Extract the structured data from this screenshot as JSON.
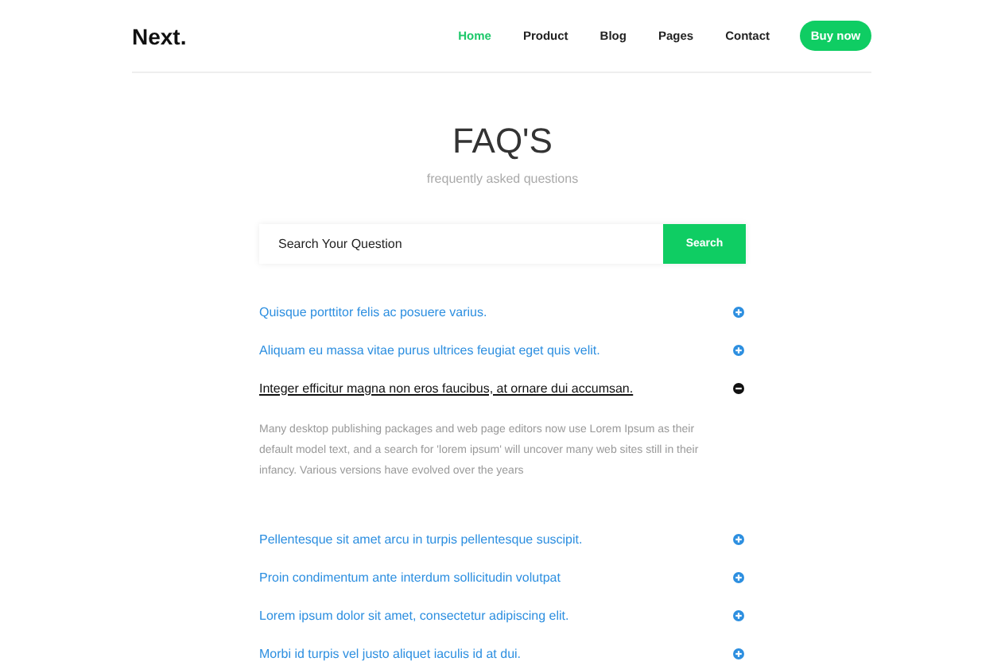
{
  "header": {
    "logo": "Next.",
    "nav": [
      {
        "label": "Home",
        "selected": true
      },
      {
        "label": "Product",
        "selected": false
      },
      {
        "label": "Blog",
        "selected": false
      },
      {
        "label": "Pages",
        "selected": false
      },
      {
        "label": "Contact",
        "selected": false
      }
    ],
    "cta": "Buy now"
  },
  "title": "FAQ'S",
  "subtitle": "frequently asked questions",
  "search": {
    "placeholder": "Search Your Question",
    "button": "Search"
  },
  "faqs": [
    {
      "question": "Quisque porttitor felis ac posuere varius.",
      "expanded": false
    },
    {
      "question": "Aliquam eu massa vitae purus ultrices feugiat eget quis velit.",
      "expanded": false
    },
    {
      "question": "Integer efficitur magna non eros faucibus, at ornare dui accumsan.",
      "expanded": true,
      "answer": "Many desktop publishing packages and web page editors now use Lorem Ipsum as their default model text, and a search for 'lorem ipsum' will uncover many web sites still in their infancy. Various versions have evolved over the years"
    },
    {
      "question": "Pellentesque sit amet arcu in turpis pellentesque suscipit.",
      "expanded": false
    },
    {
      "question": "Proin condimentum ante interdum sollicitudin volutpat",
      "expanded": false
    },
    {
      "question": "Lorem ipsum dolor sit amet, consectetur adipiscing elit.",
      "expanded": false
    },
    {
      "question": "Morbi id turpis vel justo aliquet iaculis id at dui.",
      "expanded": false
    }
  ]
}
